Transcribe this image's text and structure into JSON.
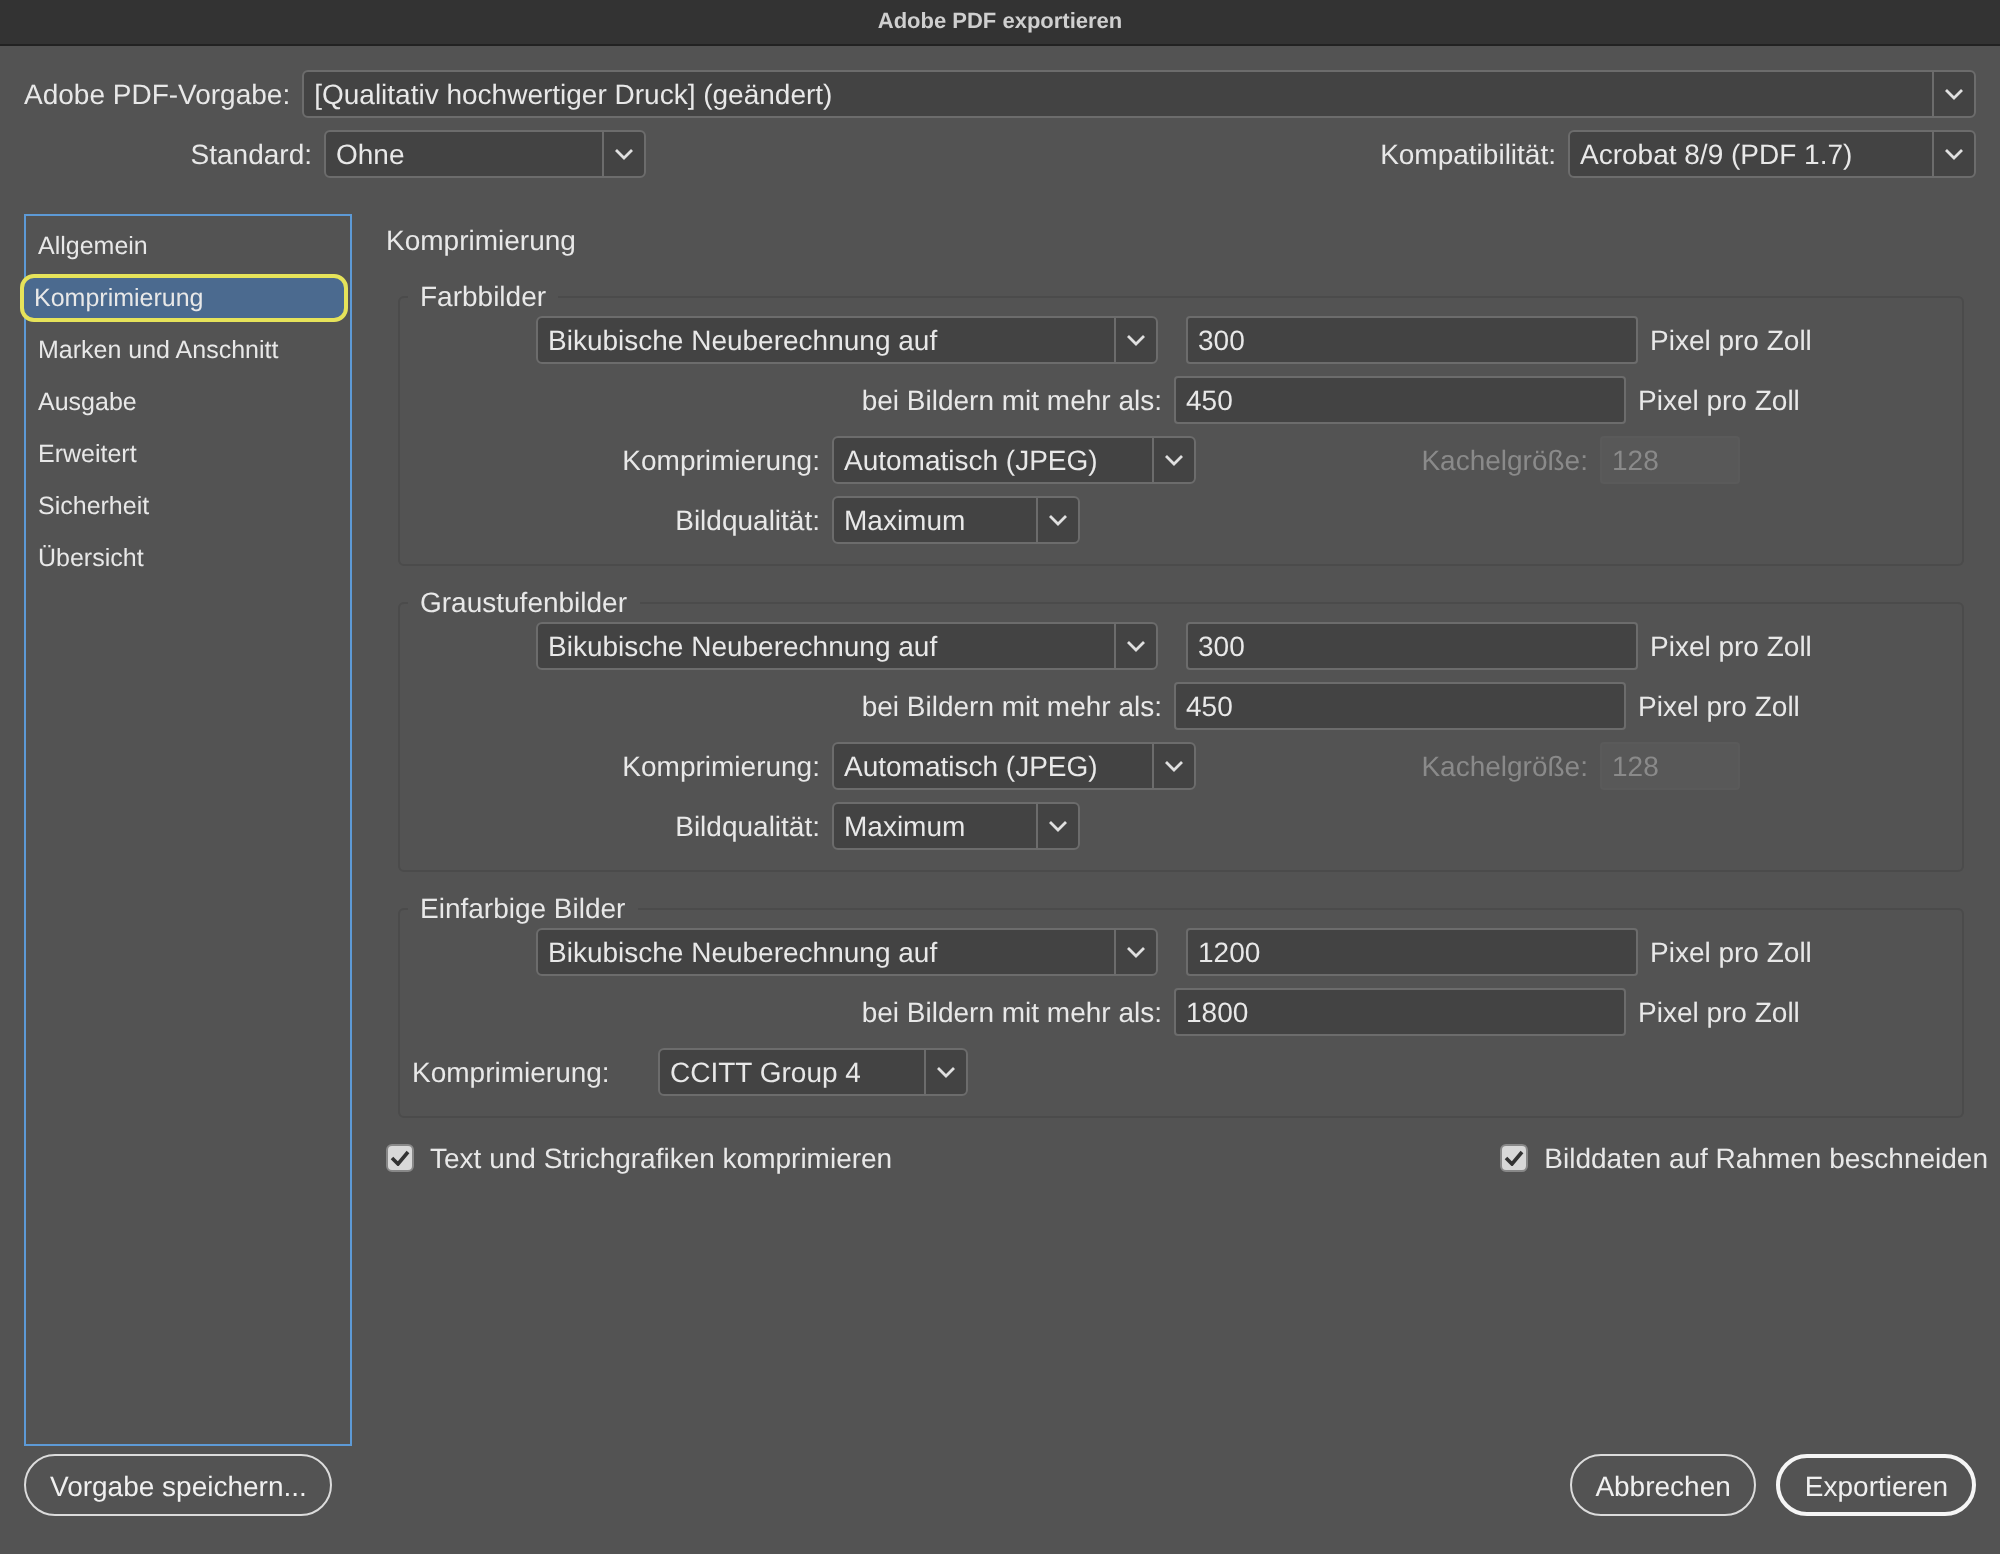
{
  "window": {
    "title": "Adobe PDF exportieren"
  },
  "preset": {
    "label": "Adobe PDF-Vorgabe:",
    "value": "[Qualitativ hochwertiger Druck] (geändert)"
  },
  "standard": {
    "label": "Standard:",
    "value": "Ohne"
  },
  "compatibility": {
    "label": "Kompatibilität:",
    "value": "Acrobat 8/9 (PDF 1.7)"
  },
  "sidebar": {
    "items": [
      {
        "label": "Allgemein",
        "selected": false
      },
      {
        "label": "Komprimierung",
        "selected": true
      },
      {
        "label": "Marken und Anschnitt",
        "selected": false
      },
      {
        "label": "Ausgabe",
        "selected": false
      },
      {
        "label": "Erweitert",
        "selected": false
      },
      {
        "label": "Sicherheit",
        "selected": false
      },
      {
        "label": "Übersicht",
        "selected": false
      }
    ]
  },
  "panel_title": "Komprimierung",
  "sections": [
    {
      "title": "Farbbilder",
      "kind": "full",
      "resample": "Bikubische Neuberechnung auf",
      "resolution": "300",
      "unit_1": "Pixel pro Zoll",
      "threshold_label": "bei Bildern mit mehr als:",
      "threshold": "450",
      "unit_2": "Pixel pro Zoll",
      "compression_label": "Komprimierung:",
      "compression": "Automatisch (JPEG)",
      "tile_label": "Kachelgröße:",
      "tile": "128",
      "tile_disabled": true,
      "quality_label": "Bildqualität:",
      "quality": "Maximum"
    },
    {
      "title": "Graustufenbilder",
      "kind": "full",
      "resample": "Bikubische Neuberechnung auf",
      "resolution": "300",
      "unit_1": "Pixel pro Zoll",
      "threshold_label": "bei Bildern mit mehr als:",
      "threshold": "450",
      "unit_2": "Pixel pro Zoll",
      "compression_label": "Komprimierung:",
      "compression": "Automatisch (JPEG)",
      "tile_label": "Kachelgröße:",
      "tile": "128",
      "tile_disabled": true,
      "quality_label": "Bildqualität:",
      "quality": "Maximum"
    },
    {
      "title": "Einfarbige Bilder",
      "kind": "compact",
      "resample": "Bikubische Neuberechnung auf",
      "resolution": "1200",
      "unit_1": "Pixel pro Zoll",
      "threshold_label": "bei Bildern mit mehr als:",
      "threshold": "1800",
      "unit_2": "Pixel pro Zoll",
      "compression_label": "Komprimierung:",
      "compression": "CCITT Group 4"
    }
  ],
  "options": [
    {
      "label": "Text und Strichgrafiken komprimieren",
      "checked": true
    },
    {
      "label": "Bilddaten auf Rahmen beschneiden",
      "checked": true
    }
  ],
  "save_button": "Vorgabe speichern...",
  "buttons": [
    {
      "label": "Abbrechen",
      "default": false
    },
    {
      "label": "Exportieren",
      "default": true
    }
  ]
}
